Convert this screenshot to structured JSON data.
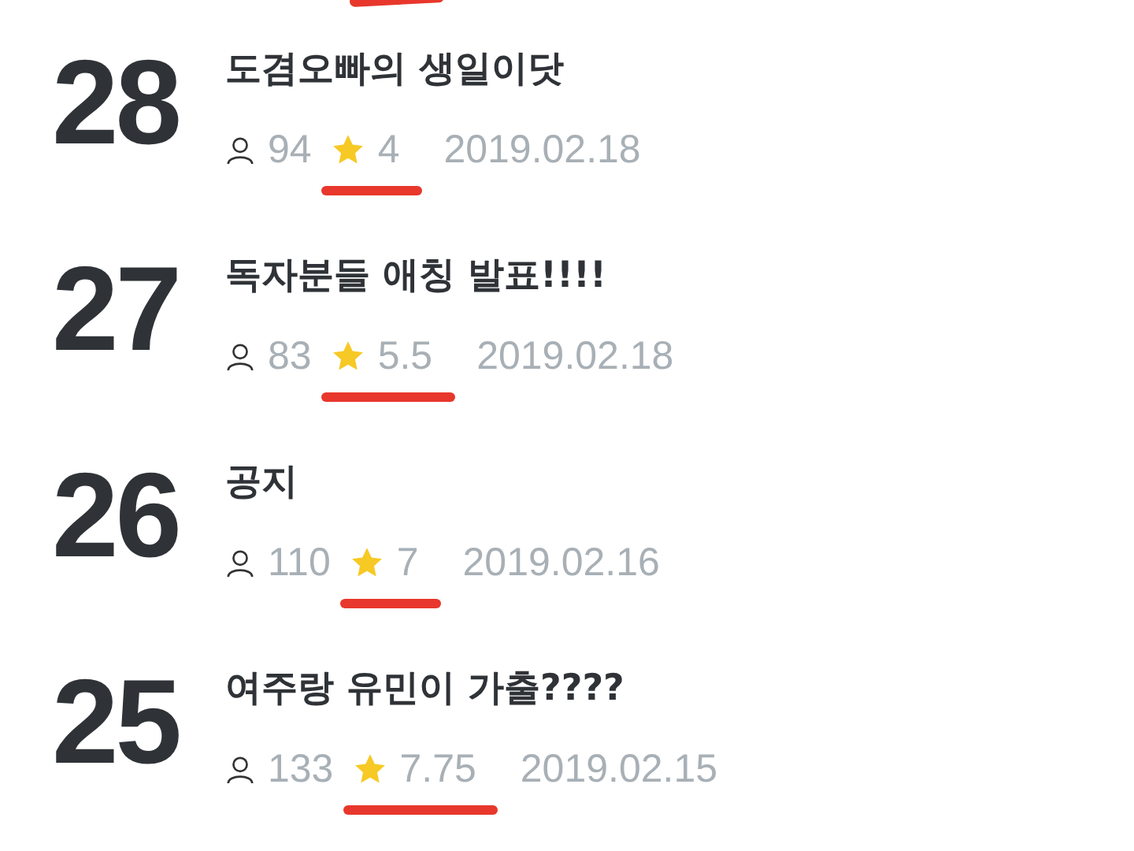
{
  "episodes": [
    {
      "number": "28",
      "title": "도겸오빠의 생일이닷",
      "views": "94",
      "rating": "4",
      "date": "2019.02.18",
      "underlined": true
    },
    {
      "number": "27",
      "title": "독자분들 애칭 발표!!!!",
      "views": "83",
      "rating": "5.5",
      "date": "2019.02.18",
      "underlined": true
    },
    {
      "number": "26",
      "title": "공지",
      "views": "110",
      "rating": "7",
      "date": "2019.02.16",
      "underlined": true
    },
    {
      "number": "25",
      "title": "여주랑 유민이 가출????",
      "views": "133",
      "rating": "7.75",
      "date": "2019.02.15",
      "underlined": true
    }
  ]
}
